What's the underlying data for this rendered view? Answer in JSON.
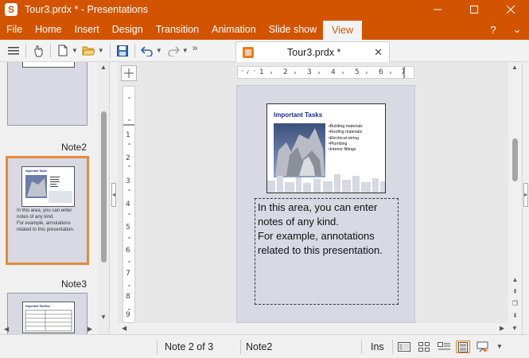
{
  "window": {
    "title": "Tour3.prdx * - Presentations",
    "app_icon": "S"
  },
  "menu": {
    "items": [
      "File",
      "Home",
      "Insert",
      "Design",
      "Transition",
      "Animation",
      "Slide show",
      "View"
    ],
    "active": "View",
    "help_icon": "?",
    "collapse_icon": "⌄"
  },
  "toolbar": {
    "more": "»"
  },
  "doc_tab": {
    "title": "Tour3.prdx *",
    "close": "✕"
  },
  "slide_panel": {
    "items": [
      {
        "label": "Note2",
        "notes": [
          "In this area, you can enter",
          "notes of any kind.",
          "For example, annotations",
          "related to this presentation."
        ]
      },
      {
        "label": "Note3"
      }
    ]
  },
  "rulers": {
    "horizontal": [
      "1",
      "2",
      "3",
      "4",
      "5",
      "6",
      "7"
    ],
    "vertical": [
      "1",
      "2",
      "3",
      "4",
      "5",
      "6",
      "7",
      "8",
      "9"
    ]
  },
  "slide": {
    "title": "Important Tasks",
    "bullets": [
      "•Building materials",
      "•Roofing materials",
      "•Electrical wiring",
      "•Plumbing",
      "•Interior fittings"
    ]
  },
  "notes": {
    "text_lines": [
      "In this area, you can enter",
      "notes of any kind.",
      "For example, annotations",
      "related to this presentation."
    ]
  },
  "status": {
    "position": "Note 2 of 3",
    "slide_name": "Note2",
    "mode": "Ins"
  },
  "colors": {
    "accent": "#d35400",
    "selected_border": "#e48a3c",
    "slide_title": "#1b2a8a"
  }
}
